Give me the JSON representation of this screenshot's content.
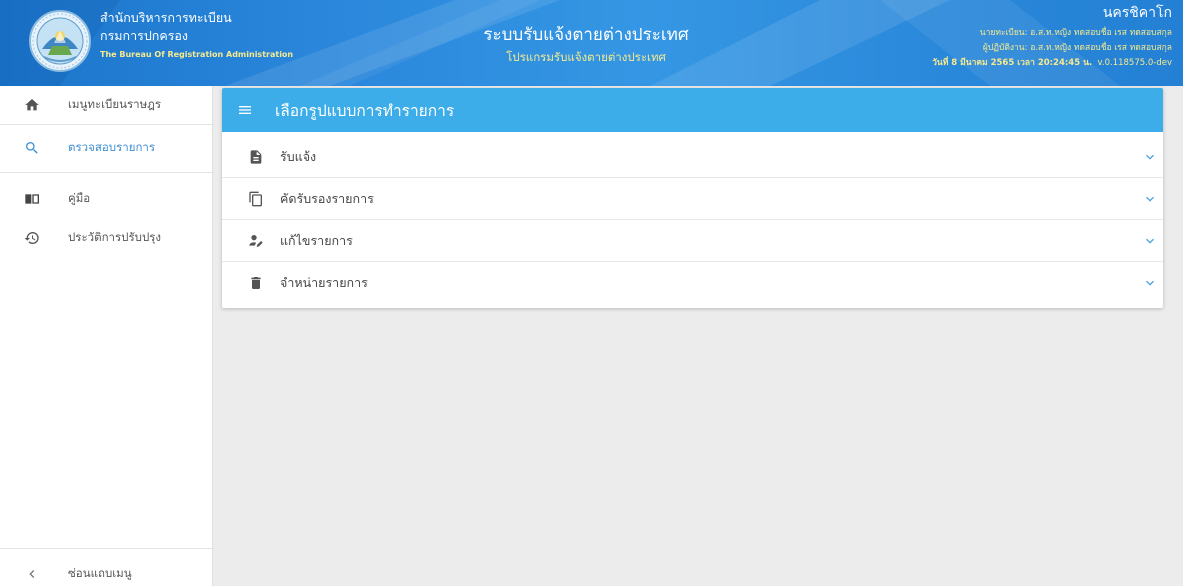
{
  "header": {
    "org_name_th": "สำนักบริหารการทะเบียน",
    "dept_name_th": "กรมการปกครอง",
    "org_name_en": "The Bureau Of Registration Administration",
    "system_title": "ระบบรับแจ้งตายต่างประเทศ",
    "program_title": "โปรแกรมรับแจ้งตายต่างประเทศ",
    "office": "นครชิคาโก",
    "registrar": "นายทะเบียน: อ.ส.ท.หญิง ทดสอบชื่อ เรส ทดสอบสกุล",
    "operator": "ผู้ปฏิบัติงาน: อ.ส.ท.หญิง ทดสอบชื่อ เรส ทดสอบสกุล",
    "datetime": "วันที่ 8 มีนาคม 2565 เวลา 20:24:45 น.",
    "version": "v.0.118575.0-dev",
    "logo_icon": "department-seal-logo"
  },
  "sidebar": {
    "items": [
      {
        "label": "เมนูทะเบียนราษฎร",
        "icon": "home-icon"
      },
      {
        "label": "ตรวจสอบรายการ",
        "icon": "search-icon",
        "active": true
      },
      {
        "label": "คู่มือ",
        "icon": "book-icon"
      },
      {
        "label": "ประวัติการปรับปรุง",
        "icon": "history-icon"
      }
    ],
    "collapse_label": "ซ่อนแถบเมนู",
    "collapse_icon": "chevron-left-icon"
  },
  "panel": {
    "title": "เลือกรูปแบบการทำรายการ",
    "title_icon": "menu-icon",
    "options": [
      {
        "label": "รับแจ้ง",
        "icon": "file-icon"
      },
      {
        "label": "คัดรับรองรายการ",
        "icon": "copy-icon"
      },
      {
        "label": "แก้ไขรายการ",
        "icon": "person-edit-icon"
      },
      {
        "label": "จำหน่ายรายการ",
        "icon": "trash-icon"
      }
    ],
    "expand_icon": "chevron-down-icon"
  },
  "colors": {
    "header_blue": "#2b88dc",
    "panel_header_blue": "#3dadea",
    "active_blue": "#3e8fd3",
    "subtitle_yellow": "#f6ea8e",
    "chevron_blue": "#4aa3df",
    "content_background": "#ececec"
  }
}
